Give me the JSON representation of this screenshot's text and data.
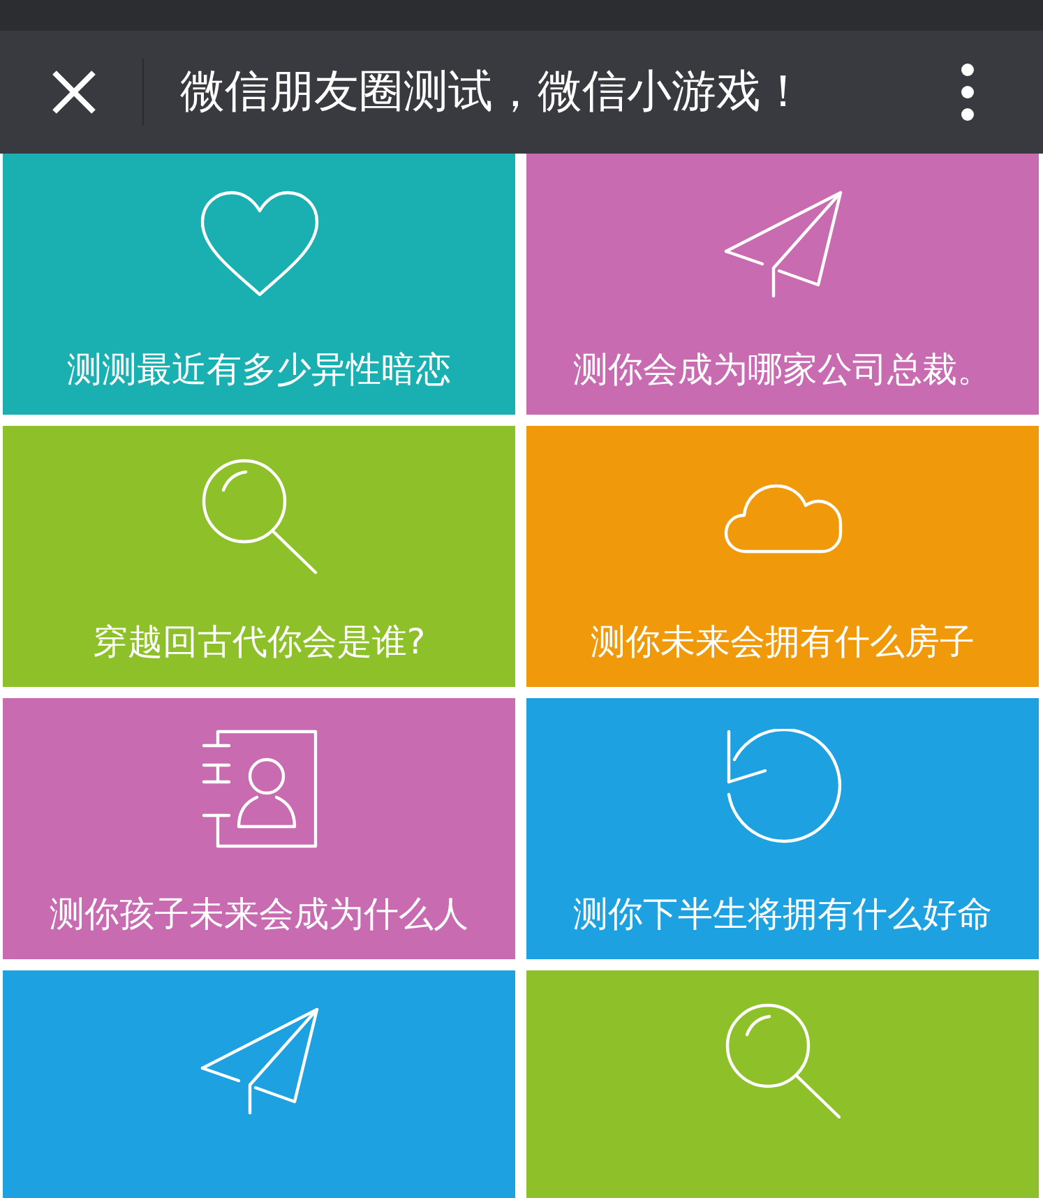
{
  "header": {
    "title": "微信朋友圈测试，微信小游戏！"
  },
  "tiles": [
    {
      "label": "测测最近有多少异性暗恋",
      "kind": "heart",
      "color": "#1aafb0"
    },
    {
      "label": "测你会成为哪家公司总裁。",
      "kind": "plane",
      "color": "#c86bb0"
    },
    {
      "label": "穿越回古代你会是谁?",
      "kind": "magnifier",
      "color": "#8ec02a"
    },
    {
      "label": "测你未来会拥有什么房子",
      "kind": "cloud",
      "color": "#f0990a"
    },
    {
      "label": "测你孩子未来会成为什么人",
      "kind": "contact",
      "color": "#c86bb0"
    },
    {
      "label": "测你下半生将拥有什么好命",
      "kind": "refresh",
      "color": "#1ea1e0"
    },
    {
      "kind": "plane",
      "color": "#1ea1e0"
    },
    {
      "kind": "magnifier",
      "color": "#8ec02a"
    }
  ]
}
